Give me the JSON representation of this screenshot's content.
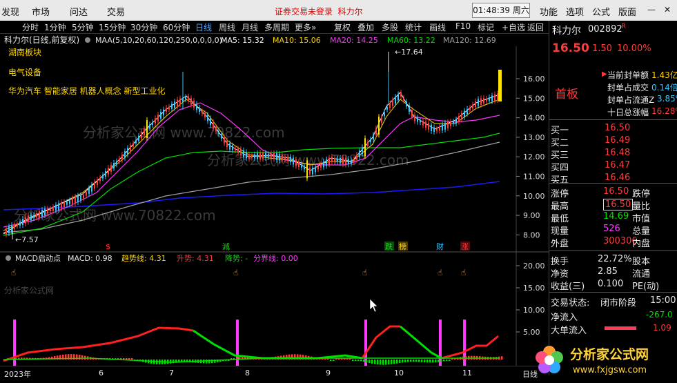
{
  "menubar": {
    "items": [
      "发现",
      "市场",
      "问达",
      "交易"
    ],
    "notice": "证券交易未登录",
    "notice_stock": "科力尔",
    "clock": "01:48:39 周六",
    "right_items": [
      "功能",
      "选项",
      "公式",
      "版面"
    ]
  },
  "toolbar": {
    "periods": [
      "分时",
      "1分钟",
      "5分钟",
      "15分钟",
      "30分钟",
      "60分钟",
      "日线",
      "周线",
      "月线",
      "多周期",
      "更多"
    ],
    "active": "日线",
    "tools": [
      "复权",
      "叠加",
      "多股",
      "统计",
      "画线",
      "F10",
      "标记",
      "+自选",
      "返回"
    ]
  },
  "chart": {
    "title": "科力尔(日线,前复权)",
    "ma_label": "MAA(5,10,20,60,120,250,0,0,0,0)",
    "ma_values": [
      {
        "label": "MA5: 15.32",
        "color": "#ffffff"
      },
      {
        "label": "MA10: 15.06",
        "color": "#ffd800"
      },
      {
        "label": "MA20: 14.25",
        "color": "#ff37ff"
      },
      {
        "label": "MA60: 13.22",
        "color": "#00e000"
      },
      {
        "label": "MA120: 12.69",
        "color": "#a0a0a0"
      }
    ],
    "tags": [
      "湖南板块",
      "电气设备",
      "华为汽车 智能家居 机器人概念 新型工业化"
    ],
    "high_label": "17.64",
    "low_label": "7.57",
    "y_ticks": [
      "16.00",
      "15.00",
      "14.00",
      "13.00",
      "12.00",
      "11.00",
      "10.00",
      "9.00",
      "8.00"
    ],
    "event_marks": [
      {
        "label": "$",
        "color": "#ff3b3b"
      },
      {
        "label": "減",
        "color": "#00e000"
      },
      {
        "label": "跌",
        "color": "#00e000"
      },
      {
        "label": "榜",
        "color": "#ffd800"
      },
      {
        "label": "财",
        "color": "#36c5ff"
      },
      {
        "label": "涨",
        "color": "#ff3b3b"
      }
    ],
    "watermark": "分析家公式网 www.70822.com"
  },
  "indicator": {
    "name": "MACD启动点",
    "macd": "MACD: 0.98",
    "trend": "趋势线: 4.31",
    "rise": "升势: 4.31",
    "fall": "降势: -",
    "divide": "分界线: 0.00",
    "y_ticks": [
      "20.00",
      "15.00",
      "10.00",
      "5.00"
    ],
    "watermark": "分析家公式网"
  },
  "x_axis": [
    "2023年",
    "6",
    "7",
    "8",
    "9",
    "10",
    "11"
  ],
  "right_panel": {
    "name": "科力尔",
    "code": "002892",
    "code_flag": "R",
    "price": "16.50",
    "change": "1.50",
    "pct": "10.00%",
    "board": "首板",
    "limit_rows": [
      {
        "label": "当前封单额",
        "value": "1.43亿"
      },
      {
        "label": "封单占成交",
        "value": "0.14倍"
      },
      {
        "label": "封单占流通Z",
        "value": "3.85%"
      },
      {
        "label": "十日总涨幅",
        "value": "16.28%"
      }
    ],
    "bids": [
      {
        "label": "买一",
        "price": "16.50"
      },
      {
        "label": "买二",
        "price": "16.49"
      },
      {
        "label": "买三",
        "price": "16.48"
      },
      {
        "label": "买四",
        "price": "16.47"
      },
      {
        "label": "买五",
        "price": "16.46"
      }
    ],
    "stats": [
      {
        "label": "涨停",
        "value": "16.50",
        "label2": "跌停"
      },
      {
        "label": "最高",
        "value": "16.50",
        "label2": "量比"
      },
      {
        "label": "最低",
        "value": "14.69",
        "label2": "市值"
      },
      {
        "label": "现量",
        "value": "526",
        "label2": "总量"
      },
      {
        "label": "外盘",
        "value": "300306",
        "label2": "内盘"
      }
    ],
    "stats2": [
      {
        "label": "换手",
        "value": "22.72%",
        "label2": "股本"
      },
      {
        "label": "净资",
        "value": "2.85",
        "label2": "流通"
      },
      {
        "label": "收益(三)",
        "value": "0.100",
        "label2": "PE(动)"
      }
    ],
    "trade_status_label": "交易状态:",
    "trade_status": "闭市阶段",
    "trade_time": "15:00",
    "net_inflow_label": "净流入",
    "net_inflow": "-267.0",
    "big_inflow_label": "大单流入",
    "big_inflow": "1.09"
  },
  "logo": {
    "text": "分析家公式网",
    "url": "www.fxjgsw.com"
  },
  "bottom": {
    "right_label": "日线"
  }
}
